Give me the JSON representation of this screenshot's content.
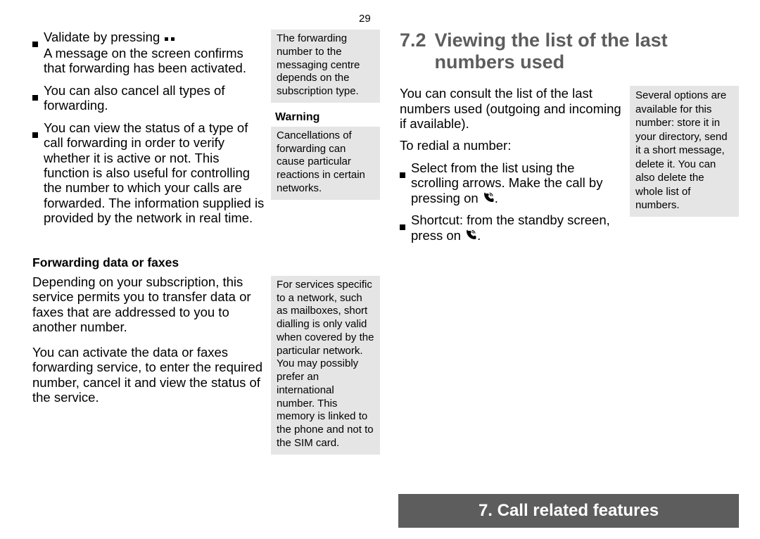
{
  "page_number": "29",
  "left": {
    "bullets": [
      "Validate by pressing  ⠂⠂\nA message on the screen confirms that forwarding has been activated.",
      "You can also cancel all types of forwarding.",
      "You can view the status of a type of call forwarding in order to verify whether it is active or not. This function is also useful for controlling the number to which your calls are forwarded. The information supplied is provided by the network in real time."
    ],
    "note1": "The forwarding number to the messaging centre depends on the subscription type.",
    "warning_heading": "Warning",
    "note2": "Cancellations of forwarding can cause particular reactions in certain networks.",
    "sub_heading": "Forwarding data or faxes",
    "para1": "Depending on your subscription, this service permits you to transfer data or faxes that are addressed to you to another number.",
    "para2": "You can activate the data or faxes forwarding service, to enter the required number, cancel it and view the status of the service.",
    "note3": "For services specific to a network, such as mailboxes, short dialling is only valid when covered by the particular network. You may possibly prefer an international number. This memory is linked to the phone and not to the SIM card."
  },
  "right": {
    "section_number": "7.2",
    "section_title": "Viewing the list of the last numbers used",
    "intro": "You can consult the list of the last numbers used (outgoing and incoming if available).",
    "note": "Several options are available for this number: store it in your directory, send it a short message, delete it. You can also delete the whole list of numbers.",
    "redial_heading": "To redial a number:",
    "bullets": [
      "Select from the list using the scrolling arrows. Make the call by pressing on ",
      "Shortcut: from the standby screen, press on "
    ]
  },
  "chapter_banner": "7. Call related features"
}
